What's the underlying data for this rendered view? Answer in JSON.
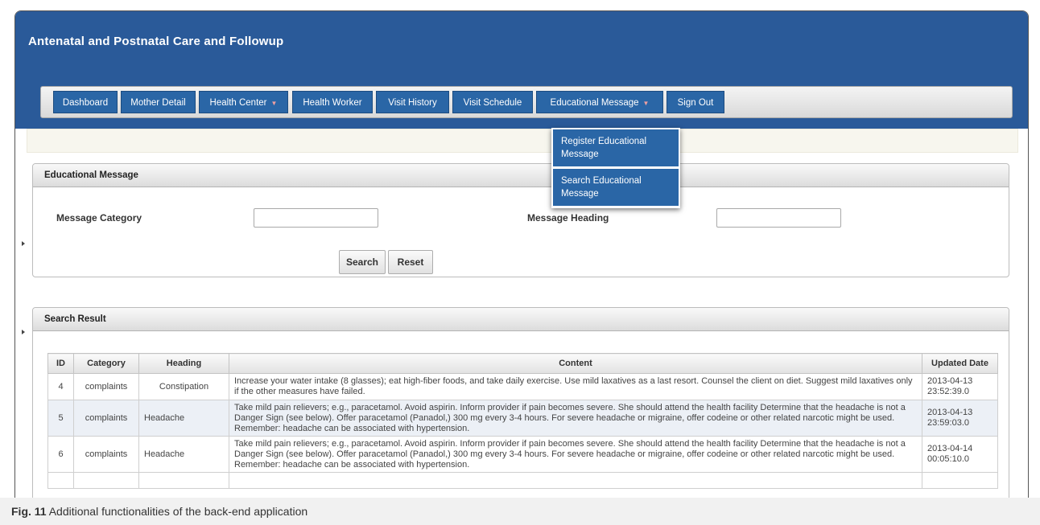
{
  "app": {
    "title": "Antenatal and Postnatal Care and Followup"
  },
  "nav": [
    {
      "label": "Dashboard"
    },
    {
      "label": "Mother Detail"
    },
    {
      "label": "Health Center"
    },
    {
      "label": "Health Worker"
    },
    {
      "label": "Visit History"
    },
    {
      "label": "Visit Schedule"
    },
    {
      "label": "Educational Message"
    },
    {
      "label": "Sign Out"
    }
  ],
  "dropdown": {
    "items": [
      {
        "label": "Register Educational Message"
      },
      {
        "label": "Search Educational Message"
      }
    ]
  },
  "search_panel": {
    "title": "Educational Message",
    "category_label": "Message Category",
    "category_value": "",
    "heading_label": "Message Heading",
    "heading_value": "",
    "search_label": "Search",
    "reset_label": "Reset"
  },
  "results_panel": {
    "title": "Search Result",
    "columns": [
      "ID",
      "Category",
      "Heading",
      "Content",
      "Updated Date"
    ],
    "rows": [
      {
        "id": "4",
        "category": "complaints",
        "heading": "Constipation",
        "content": "Increase your water intake (8 glasses); eat high-fiber foods, and take daily exercise. Use mild laxatives as a last resort. Counsel the client on diet. Suggest mild laxatives only if the other measures have failed.",
        "date": "2013-04-13",
        "time": "23:52:39.0"
      },
      {
        "id": "5",
        "category": "complaints",
        "heading": "Headache",
        "content": "Take mild pain relievers; e.g., paracetamol. Avoid aspirin. Inform provider if pain becomes severe. She should attend the health facility Determine that the headache is not a Danger Sign (see below). Offer paracetamol (Panadol,) 300 mg every 3-4 hours. For severe headache or migraine, offer codeine or other related narcotic might be used. Remember: headache can be associated with hypertension.",
        "date": "2013-04-13",
        "time": "23:59:03.0"
      },
      {
        "id": "6",
        "category": "complaints",
        "heading": "Headache",
        "content": "Take mild pain relievers; e.g., paracetamol. Avoid aspirin. Inform provider if pain becomes severe. She should attend the health facility Determine that the headache is not a Danger Sign (see below). Offer paracetamol (Panadol,) 300 mg every 3-4 hours. For severe headache or migraine, offer codeine or other related narcotic might be used. Remember: headache can be associated with hypertension.",
        "date": "2013-04-14",
        "time": "00:05:10.0"
      }
    ]
  },
  "caption": {
    "label": "Fig. 11",
    "text": "Additional functionalities of the back-end application"
  },
  "colors": {
    "header_bg": "#2a5a99",
    "nav_button_bg": "#2a66a6",
    "alt_row_bg": "#ecf0f6"
  }
}
